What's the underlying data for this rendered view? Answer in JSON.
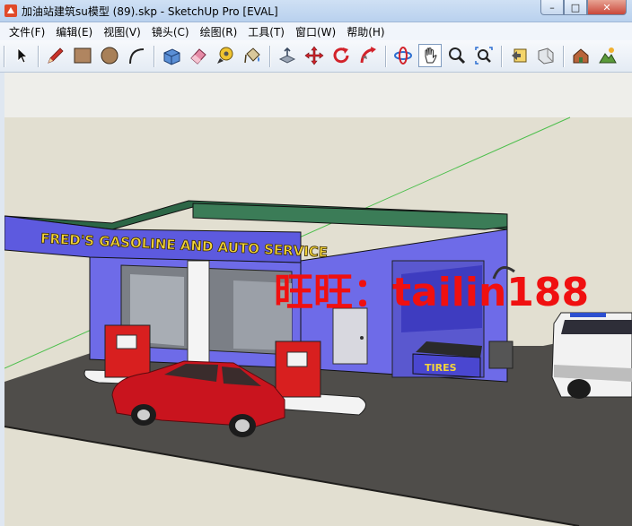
{
  "window": {
    "title": "加油站建筑su模型  (89).skp - SketchUp Pro [EVAL]",
    "minimize": "–",
    "maximize": "□",
    "close": "✕"
  },
  "menu": {
    "items": [
      "文件(F)",
      "编辑(E)",
      "视图(V)",
      "镜头(C)",
      "绘图(R)",
      "工具(T)",
      "窗口(W)",
      "帮助(H)"
    ]
  },
  "toolbar": {
    "tools": [
      "select",
      "line",
      "rectangle",
      "circle",
      "arc",
      "push-pull",
      "eraser",
      "tape-measure",
      "paint-bucket",
      "move-up",
      "move",
      "rotate",
      "follow-me",
      "orbit",
      "pan",
      "zoom",
      "zoom-extents",
      "previous-view",
      "next-view",
      "add-location",
      "toggle-terrain"
    ]
  },
  "scene": {
    "sign_text": "FRED'S GASOLINE AND AUTO SERVICE",
    "tires_text": "TIRES",
    "watermark": "旺旺：tailin188",
    "colors": {
      "sky": "#dcd9cb",
      "ground": "#e2dfd1",
      "asphalt": "#55534f",
      "building": "#6e6be8",
      "roof": "#2f6b4a",
      "sign": "#5d5adf",
      "sign_text": "#f4d53a",
      "pump": "#d81f1f",
      "car": "#c9141e",
      "watermark": "#f01010"
    }
  }
}
